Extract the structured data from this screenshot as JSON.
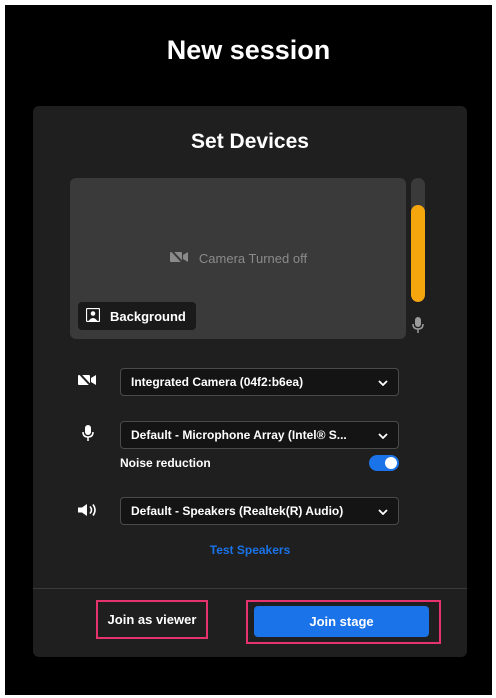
{
  "header": {
    "title": "New session"
  },
  "devices": {
    "title": "Set Devices",
    "preview": {
      "status_text": "Camera Turned off",
      "background_button_label": "Background"
    },
    "mic_level_fraction": 0.78,
    "camera": {
      "selected": "Integrated Camera (04f2:b6ea)",
      "icon": "camera-off-icon"
    },
    "microphone": {
      "selected": "Default - Microphone Array (Intel® S...",
      "icon": "microphone-icon"
    },
    "noise_reduction": {
      "label": "Noise reduction",
      "enabled": true
    },
    "speakers": {
      "selected": "Default - Speakers (Realtek(R) Audio)",
      "icon": "speaker-icon"
    },
    "test_speakers_label": "Test Speakers"
  },
  "actions": {
    "join_viewer_label": "Join as viewer",
    "join_stage_label": "Join stage"
  },
  "colors": {
    "accent": "#1a73e8",
    "meter": "#f5a60c",
    "highlight": "#e6336e",
    "panel": "#1f1f1f",
    "background": "#000000"
  }
}
